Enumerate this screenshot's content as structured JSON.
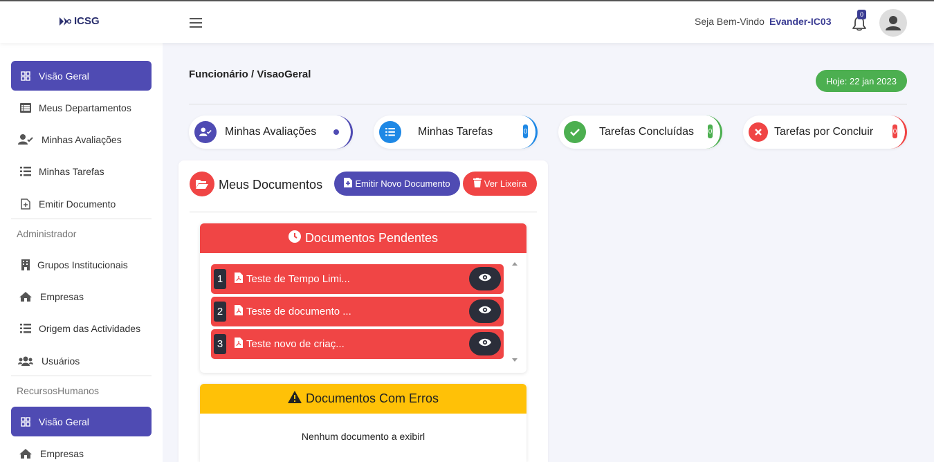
{
  "header": {
    "brand": "ICSG",
    "welcome": "Seja Bem-Vindo",
    "username": "Evander-IC03",
    "notifications_count": "0"
  },
  "sidebar": {
    "items": [
      {
        "label": "Visão Geral",
        "icon": "grid-icon",
        "active": true
      },
      {
        "label": "Meus Departamentos",
        "icon": "list-alt-icon"
      },
      {
        "label": "Minhas Avaliações",
        "icon": "user-check-icon"
      },
      {
        "label": "Minhas Tarefas",
        "icon": "list-icon"
      },
      {
        "label": "Emitir Documento",
        "icon": "file-plus-icon"
      }
    ],
    "admin_title": "Administrador",
    "admin_items": [
      {
        "label": "Grupos Institucionais",
        "icon": "building-icon"
      },
      {
        "label": "Empresas",
        "icon": "home-icon"
      },
      {
        "label": "Origem das Actividades",
        "icon": "list-icon"
      },
      {
        "label": "Usuários",
        "icon": "users-icon"
      }
    ],
    "hr_title": "RecursosHumanos",
    "hr_items": [
      {
        "label": "Visão Geral",
        "icon": "grid-icon",
        "active": true
      },
      {
        "label": "Empresas",
        "icon": "home-icon"
      }
    ]
  },
  "main": {
    "breadcrumb": "Funcionário / VisaoGeral",
    "today": "Hoje: 22 jan 2023",
    "stats": [
      {
        "label": "Minhas Avaliações",
        "icon": "user-check-icon",
        "color": "#4f4bb3",
        "count": ""
      },
      {
        "label": "Minhas Tarefas",
        "icon": "list-icon",
        "color": "#1e88e5",
        "count": "0"
      },
      {
        "label": "Tarefas Concluídas",
        "icon": "check-icon",
        "color": "#4caf50",
        "count": "0"
      },
      {
        "label": "Tarefas por Concluir",
        "icon": "close-icon",
        "color": "#f04545",
        "count": "0"
      }
    ]
  },
  "documents": {
    "title": "Meus Documentos",
    "emit_button": "Emitir Novo Documento",
    "trash_button": "Ver Lixeira",
    "pending_title": "Documentos Pendentes",
    "pending": [
      {
        "num": "1",
        "name": "Teste de Tempo Limi..."
      },
      {
        "num": "2",
        "name": "Teste de documento ..."
      },
      {
        "num": "3",
        "name": "Teste novo de criaç..."
      }
    ],
    "errors_title": "Documentos Com Erros",
    "errors_empty": "Nenhum documento a exibirl"
  },
  "colors": {
    "primary": "#4f4bb3",
    "danger": "#f04545",
    "success": "#4caf50",
    "warning": "#ffc107",
    "info": "#1e88e5"
  }
}
